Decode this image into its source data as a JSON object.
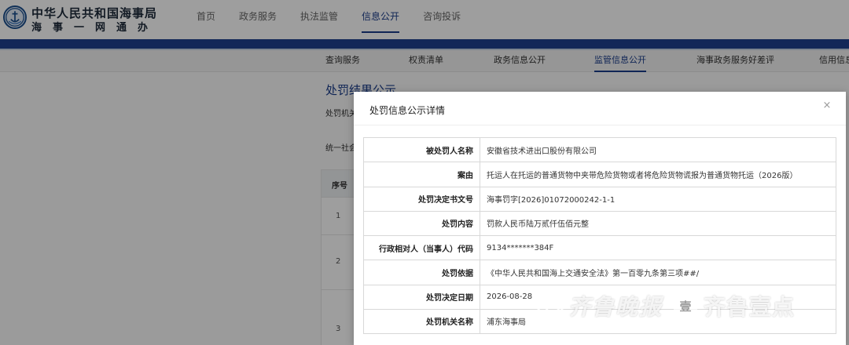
{
  "header": {
    "org_name": "中华人民共和国海事局",
    "org_sub": "海事一网通办",
    "nav": [
      {
        "label": "首页"
      },
      {
        "label": "政务服务"
      },
      {
        "label": "执法监管"
      },
      {
        "label": "信息公开",
        "active": true
      },
      {
        "label": "咨询投诉"
      }
    ]
  },
  "subnav": [
    {
      "label": "查询服务"
    },
    {
      "label": "权责清单"
    },
    {
      "label": "政务信息公开"
    },
    {
      "label": "监管信息公开",
      "active": true
    },
    {
      "label": "海事政务服务好差评"
    },
    {
      "label": "信用信息"
    }
  ],
  "page": {
    "title": "处罚结果公示",
    "filter_label": "处罚机关",
    "filter_label_2": "统一社会",
    "table_header": "序号",
    "rows": [
      "1",
      "2",
      "3"
    ]
  },
  "modal": {
    "title": "处罚信息公示详情",
    "close_symbol": "×",
    "rows": [
      {
        "key": "被处罚人名称",
        "value": "安徽省技术进出口股份有限公司"
      },
      {
        "key": "案由",
        "value": "托运人在托运的普通货物中夹带危险货物或者将危险货物谎报为普通货物托运（2026版）"
      },
      {
        "key": "处罚决定书文号",
        "value": "海事罚字[2026]01072000242-1-1"
      },
      {
        "key": "处罚内容",
        "value": "罚款人民币陆万贰仟伍佰元整"
      },
      {
        "key": "行政相对人（当事人）代码",
        "value": "9134*******384F"
      },
      {
        "key": "处罚依据",
        "value": "《中华人民共和国海上交通安全法》第一百零九条第三项##/"
      },
      {
        "key": "处罚决定日期",
        "value": "2026-08-28"
      },
      {
        "key": "处罚机关名称",
        "value": "浦东海事局"
      }
    ]
  },
  "watermark": {
    "brand_1": "齐鲁晚报",
    "badge": "壹",
    "brand_2": "齐鲁壹点"
  }
}
